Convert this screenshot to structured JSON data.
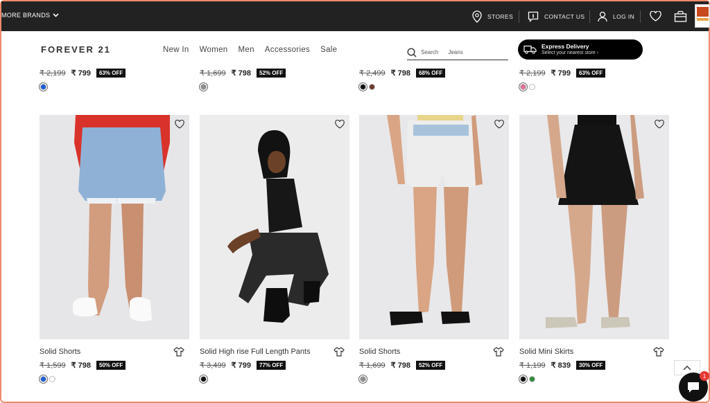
{
  "topbar": {
    "brands_label": "MORE BRANDS",
    "stores_label": "STORES",
    "contact_label": "CONTACT US",
    "login_label": "LOG IN"
  },
  "header": {
    "logo_text": "FOREVER 21",
    "nav": [
      "New In",
      "Women",
      "Men",
      "Accessories",
      "Sale"
    ],
    "search_placeholder": "Search",
    "search_term": "Jeans",
    "express_title": "Express Delivery",
    "express_subtitle": "Select your nearest store ›"
  },
  "top_row": [
    {
      "mrp": "₹ 2,199",
      "price": "₹ 799",
      "off": "63% OFF",
      "swatches": [
        "#1a5fd4"
      ]
    },
    {
      "mrp": "₹ 1,699",
      "price": "₹ 798",
      "off": "52% OFF",
      "swatches": [
        "#8d8d8d"
      ]
    },
    {
      "mrp": "₹ 2,499",
      "price": "₹ 798",
      "off": "68% OFF",
      "swatches": [
        "#111111",
        "#6b3a2a"
      ]
    },
    {
      "mrp": "₹ 2,199",
      "price": "₹ 799",
      "off": "63% OFF",
      "swatches": [
        "#e06f93",
        "#ffffff"
      ]
    }
  ],
  "products": [
    {
      "name": "Solid Shorts",
      "mrp": "₹ 1,599",
      "price": "₹ 798",
      "off": "50% OFF",
      "swatches": [
        "#1a5fd4",
        "#ffffff"
      ]
    },
    {
      "name": "Solid High rise Full Length Pants",
      "mrp": "₹ 3,499",
      "price": "₹ 799",
      "off": "77% OFF",
      "swatches": [
        "#111111"
      ]
    },
    {
      "name": "Solid Shorts",
      "mrp": "₹ 1,699",
      "price": "₹ 798",
      "off": "52% OFF",
      "swatches": [
        "#8d8d8d"
      ]
    },
    {
      "name": "Solid Mini Skirts",
      "mrp": "₹ 1,199",
      "price": "₹ 839",
      "off": "30% OFF",
      "swatches": [
        "#111111",
        "#2e8b3a"
      ]
    }
  ],
  "chat": {
    "badge": "1"
  },
  "colors": {
    "topbar": "#222222",
    "accent_border": "#f08a6a",
    "badge": "#e53935"
  }
}
